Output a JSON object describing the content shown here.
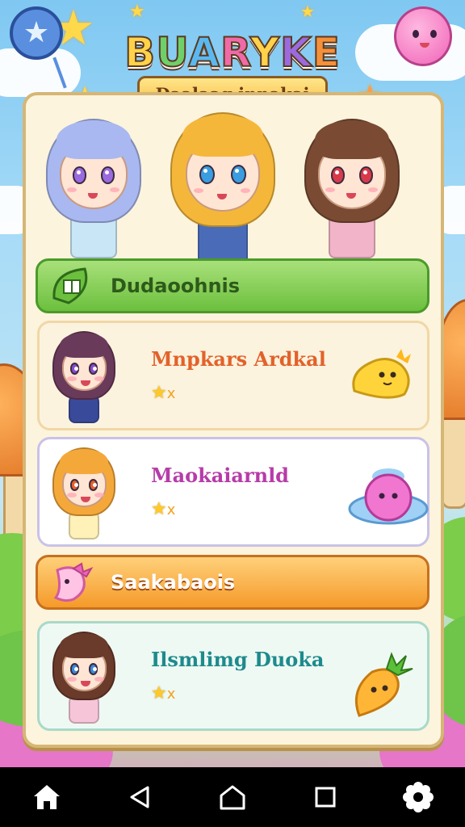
{
  "game": {
    "title": "BUARYKE",
    "subtitle": "Daalaag innakai"
  },
  "heroes": [
    {
      "hair": "#a9b8f0",
      "eye": "#9b6adf",
      "outfit": "#c9e6f7"
    },
    {
      "hair": "#f5b73a",
      "eye": "#3a9de0",
      "outfit": "#4a6cb8"
    },
    {
      "hair": "#7a4a32",
      "eye": "#d83a4a",
      "outfit": "#f2b4c8"
    }
  ],
  "sections": {
    "top_banner": "Dudaoohnis",
    "bottom_banner": "Saakabaois"
  },
  "cards": [
    {
      "name": "Mnpkars Ardkal",
      "name_color": "#e2622a",
      "stars": "★",
      "star_suffix": "x",
      "bg": "#fcf3df",
      "border": "#f1d7a6",
      "pet": "yellow-blob"
    },
    {
      "name": "Maokaiarnld",
      "name_color": "#b63ca8",
      "stars": "★",
      "star_suffix": "x",
      "bg": "#ffffff",
      "border": "#c9c2e8",
      "pet": "pink-blob"
    },
    {
      "name": "Ilsmlimg Duoka",
      "name_color": "#1e8a8c",
      "stars": "★",
      "star_suffix": "x",
      "bg": "#eef9f4",
      "border": "#a9d9c9",
      "pet": "carrot-pet"
    }
  ],
  "navbar": {
    "items": [
      "home-icon",
      "back-icon",
      "home-outline-icon",
      "recents-icon",
      "settings-gear-icon"
    ]
  },
  "colors": {
    "title_letters": [
      "#ffd24a",
      "#6fd06a",
      "#5ab8f0",
      "#f06aa8",
      "#ffd24a",
      "#9b6adf",
      "#f5903a"
    ]
  }
}
